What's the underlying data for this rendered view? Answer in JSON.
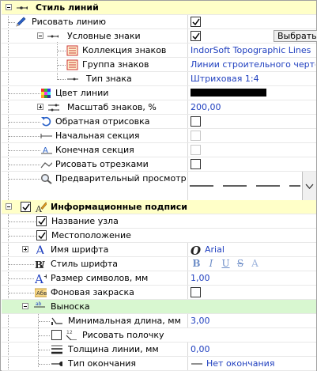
{
  "line_style": {
    "header": "Стиль линий",
    "draw_line": {
      "label": "Рисовать линию",
      "checked": true
    },
    "symbols": {
      "label": "Условные знаки",
      "checked": true,
      "choose_button": "Выбрать"
    },
    "collection": {
      "label": "Коллекция знаков",
      "value": "IndorSoft Topographic Lines"
    },
    "group": {
      "label": "Группа знаков",
      "value": "Линии строительного чертежа"
    },
    "type": {
      "label": "Тип знака",
      "value": "Штриховая 1:4"
    },
    "line_color": {
      "label": "Цвет линии",
      "color": "#000000"
    },
    "scale": {
      "label": "Масштаб знаков, %",
      "value": "200,00"
    },
    "reverse": {
      "label": "Обратная отрисовка",
      "checked": false
    },
    "start_section": {
      "label": "Начальная секция",
      "checked": false
    },
    "end_section": {
      "label": "Конечная секция",
      "checked": false
    },
    "draw_segments": {
      "label": "Рисовать отрезками",
      "checked": false
    },
    "preview": {
      "label": "Предварительный просмотр"
    }
  },
  "info_labels": {
    "header": "Информационные подписи",
    "header_checked": true,
    "node_name": {
      "label": "Название узла",
      "checked": true
    },
    "location": {
      "label": "Местоположение",
      "checked": true
    },
    "font_name": {
      "label": "Имя шрифта",
      "value": "Arial"
    },
    "font_style": {
      "label": "Стиль шрифта",
      "styles": [
        "B",
        "I",
        "U",
        "S",
        "A"
      ]
    },
    "font_size": {
      "label": "Размер символов, мм",
      "value": "1,00"
    },
    "background_fill": {
      "label": "Фоновая закраска",
      "checked": false
    },
    "callout": {
      "label": "Выноска"
    },
    "min_length": {
      "label": "Минимальная длина, мм",
      "value": "3,00"
    },
    "draw_shelf": {
      "label": "Рисовать полочку",
      "checked": false
    },
    "line_width": {
      "label": "Толщина линии, мм",
      "value": "0,00"
    },
    "end_type": {
      "label": "Тип окончания",
      "value": "Нет окончания"
    }
  },
  "colors": {
    "section_bg": "#ffffc8",
    "highlight_bg": "#d8f7d0",
    "value_text": "#1f3fbf"
  }
}
